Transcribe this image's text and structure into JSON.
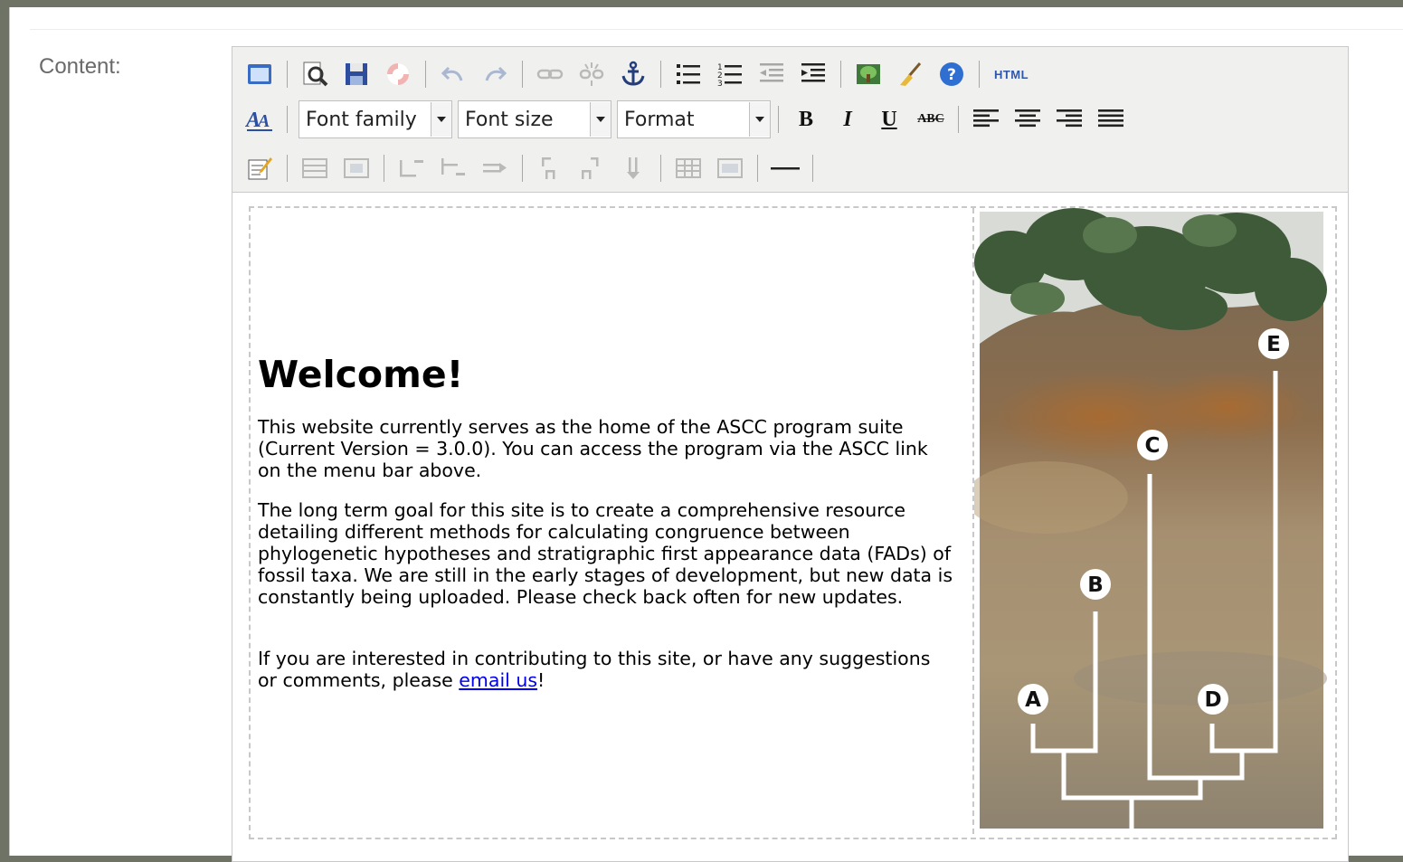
{
  "form": {
    "content_label": "Content:"
  },
  "toolbar": {
    "row1": [
      {
        "name": "preview-pane-icon",
        "dim": false
      },
      {
        "sep": true
      },
      {
        "name": "search-replace-icon",
        "dim": false
      },
      {
        "name": "save-icon",
        "dim": false
      },
      {
        "name": "lifebuoy-icon",
        "dim": false
      },
      {
        "sep": true
      },
      {
        "name": "undo-icon",
        "dim": true
      },
      {
        "name": "redo-icon",
        "dim": true
      },
      {
        "sep": true
      },
      {
        "name": "link-icon",
        "dim": true
      },
      {
        "name": "unlink-icon",
        "dim": true
      },
      {
        "name": "anchor-icon",
        "dim": false
      },
      {
        "sep": true
      },
      {
        "name": "bullet-list-icon",
        "dim": false
      },
      {
        "name": "numbered-list-icon",
        "dim": false
      },
      {
        "name": "outdent-icon",
        "dim": true
      },
      {
        "name": "indent-icon",
        "dim": false
      },
      {
        "sep": true
      },
      {
        "name": "insert-image-icon",
        "dim": false
      },
      {
        "name": "cleanup-brush-icon",
        "dim": false
      },
      {
        "name": "help-icon",
        "dim": false
      },
      {
        "sep": true
      },
      {
        "name": "html-source-icon",
        "dim": false,
        "label": "HTML"
      }
    ],
    "font_family": "Font family",
    "font_size": "Font size",
    "format": "Format",
    "format_buttons": [
      {
        "name": "bold-button",
        "label": "B"
      },
      {
        "name": "italic-button",
        "label": "I"
      },
      {
        "name": "underline-button",
        "label": "U"
      },
      {
        "name": "strikethrough-button",
        "label": "ABC"
      }
    ],
    "align_buttons": [
      "align-left-icon",
      "align-center-icon",
      "align-right-icon",
      "align-justify-icon"
    ],
    "row3": [
      {
        "name": "edit-css-icon",
        "dim": false
      },
      {
        "sep": true
      },
      {
        "name": "row-properties-icon",
        "dim": true
      },
      {
        "name": "cell-properties-icon",
        "dim": true
      },
      {
        "sep": true
      },
      {
        "name": "insert-row-before-icon",
        "dim": true
      },
      {
        "name": "insert-row-after-icon",
        "dim": true
      },
      {
        "name": "delete-row-icon",
        "dim": true
      },
      {
        "sep": true
      },
      {
        "name": "insert-col-before-icon",
        "dim": true
      },
      {
        "name": "insert-col-after-icon",
        "dim": true
      },
      {
        "name": "delete-col-icon",
        "dim": true
      },
      {
        "sep": true
      },
      {
        "name": "split-cells-icon",
        "dim": true
      },
      {
        "name": "merge-cells-icon",
        "dim": true
      },
      {
        "sep": true
      },
      {
        "name": "horizontal-rule-icon",
        "dim": false
      },
      {
        "sep": true
      }
    ]
  },
  "document": {
    "title": "Welcome!",
    "p1": "This website currently serves as the home of the ASCC program suite (Current Version = 3.0.0). You can access the program via the ASCC link on the menu bar above.",
    "p2": "The long term goal for this site is to create a comprehensive resource detailing different methods for calculating congruence between phylogenetic hypotheses and stratigraphic first appearance data (FADs) of fossil taxa. We are still in the early stages of development, but new data is constantly being uploaded. Please check back often for new updates.",
    "p3_before": "If you are interested in contributing to this site, or have any suggestions or comments, please ",
    "p3_link": "email us",
    "p3_after": "!",
    "figure_labels": [
      "A",
      "B",
      "C",
      "D",
      "E"
    ]
  },
  "colors": {
    "toolbar_bg": "#f0f0ee",
    "link": "#0000ee",
    "page_bg": "#6f7366"
  }
}
